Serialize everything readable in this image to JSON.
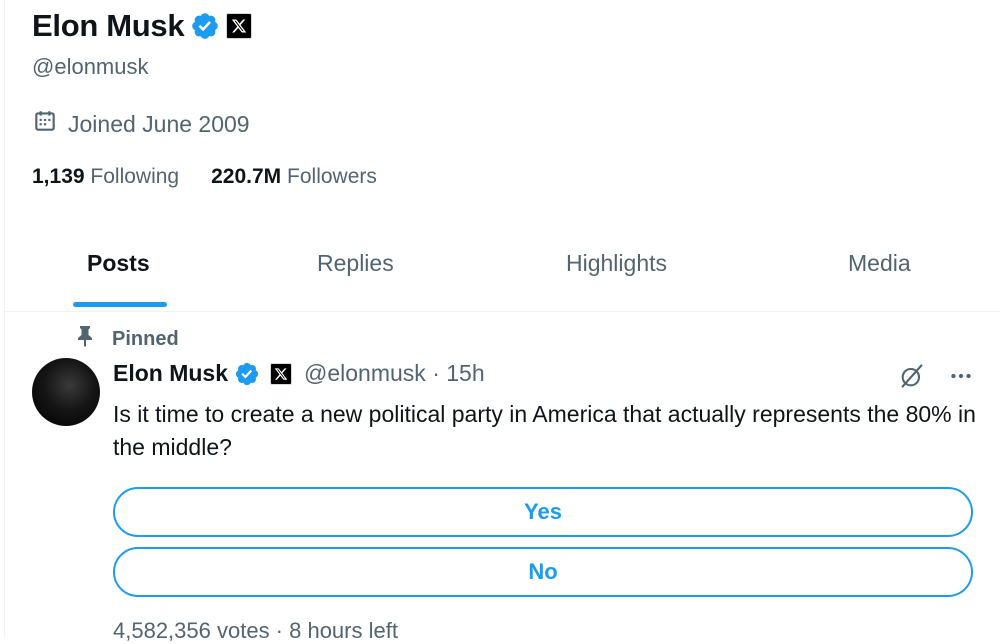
{
  "profile": {
    "name": "Elon Musk",
    "handle": "@elonmusk",
    "joined": "Joined June 2009",
    "following_count": "1,139",
    "following_label": "Following",
    "followers_count": "220.7M",
    "followers_label": "Followers"
  },
  "tabs": [
    {
      "label": "Posts",
      "active": true
    },
    {
      "label": "Replies",
      "active": false
    },
    {
      "label": "Highlights",
      "active": false
    },
    {
      "label": "Media",
      "active": false
    }
  ],
  "pinned_post": {
    "pinned_label": "Pinned",
    "author_name": "Elon Musk",
    "author_handle": "@elonmusk",
    "separator": "·",
    "time": "15h",
    "text": "Is it time to create a new political party in America that actually represents the 80% in the middle?",
    "poll": {
      "options": [
        "Yes",
        "No"
      ],
      "footer": "4,582,356 votes · 8 hours left"
    }
  },
  "colors": {
    "accent": "#1d9bf0",
    "text_primary": "#0f1419",
    "text_secondary": "#536471",
    "border": "#eff3f4"
  },
  "icons": {
    "verified": "verified-badge-icon",
    "affiliate": "x-logo-icon",
    "calendar": "calendar-icon",
    "pin": "pin-icon",
    "grok": "grok-icon",
    "more": "more-icon"
  }
}
